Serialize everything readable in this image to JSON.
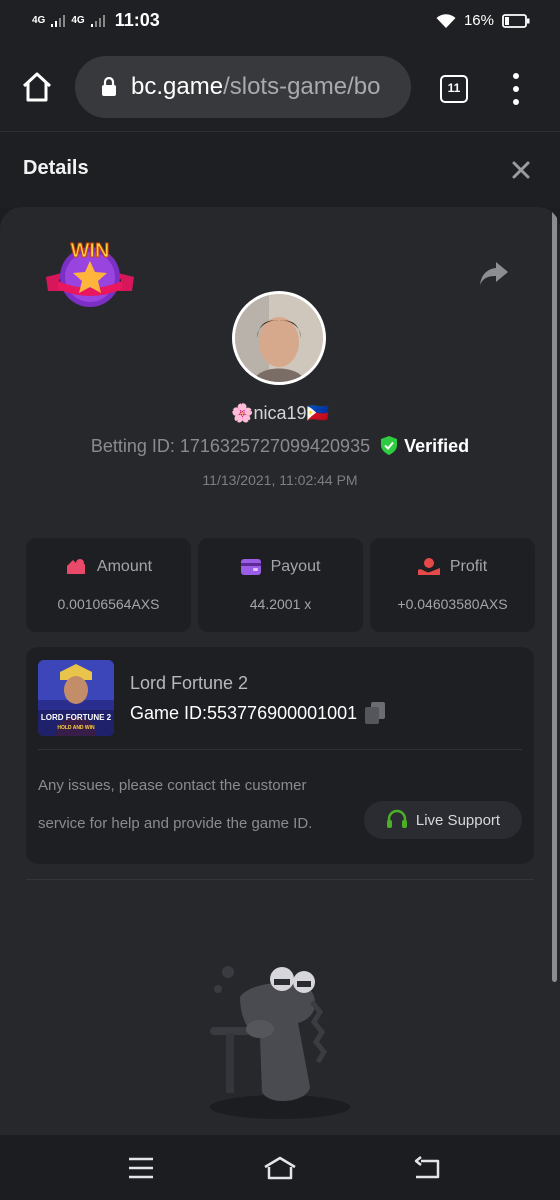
{
  "status_bar": {
    "network_1": "4G",
    "network_2": "4G",
    "time": "11:03",
    "battery": "16%",
    "icons": [
      "signal-icon",
      "wifi-icon",
      "battery-icon"
    ]
  },
  "browser": {
    "url_host": "bc.game",
    "url_path": "/slots-game/bo",
    "tab_count": "11"
  },
  "details": {
    "title": "Details",
    "badge": "WIN",
    "username": "🌸nica19🇵🇭",
    "betting_id": "Betting ID: 1716325727099420935",
    "verified": "Verified",
    "datetime": "11/13/2021, 11:02:44 PM"
  },
  "stats": [
    {
      "label": "Amount",
      "value": "0.00106564AXS",
      "icon": "amount-icon",
      "color": "#e94a6a"
    },
    {
      "label": "Payout",
      "value": "44.2001 x",
      "icon": "wallet-icon",
      "color": "#9b5de5"
    },
    {
      "label": "Profit",
      "value": "+0.04603580AXS",
      "icon": "profit-icon",
      "color": "#e6494a"
    }
  ],
  "game": {
    "name": "Lord Fortune 2",
    "game_id": "Game ID:553776900001001",
    "thumb_title": "LORD FORTUNE 2",
    "thumb_sub": "HOLD AND WIN",
    "support_text": "Any issues, please contact the customer service for help and provide the game ID.",
    "support_button": "Live Support"
  },
  "colors": {
    "background": "#27282c",
    "card": "#1e1f23",
    "verified_green": "#2ecc40",
    "support_green": "#4caf28"
  }
}
